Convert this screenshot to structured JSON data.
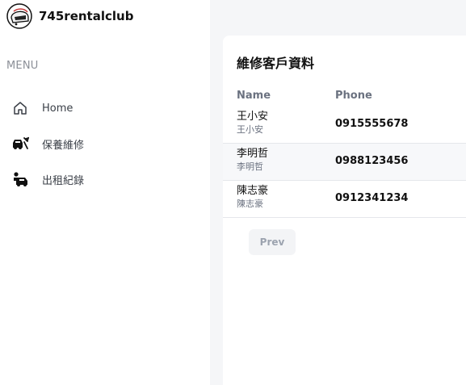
{
  "brand": {
    "name": "745rentalclub"
  },
  "sidebar": {
    "menu_label": "MENU",
    "items": [
      {
        "label": "Home",
        "icon": "home-icon"
      },
      {
        "label": "保養維修",
        "icon": "car-repair-icon"
      },
      {
        "label": "出租紀錄",
        "icon": "car-rental-icon"
      }
    ]
  },
  "main": {
    "title": "維修客戶資料",
    "table": {
      "columns": [
        "Name",
        "Phone"
      ],
      "rows": [
        {
          "name": "王小安",
          "subname": "王小安",
          "phone": "0915555678"
        },
        {
          "name": "李明哲",
          "subname": "李明哲",
          "phone": "0988123456"
        },
        {
          "name": "陳志豪",
          "subname": "陳志豪",
          "phone": "0912341234"
        }
      ]
    },
    "pagination": {
      "prev_label": "Prev"
    }
  },
  "colors": {
    "page_bg": "#f5f6f8",
    "surface": "#ffffff",
    "muted_text": "#6b7280",
    "row_alt": "#f7f8fa",
    "button_bg": "#f3f4f6"
  }
}
